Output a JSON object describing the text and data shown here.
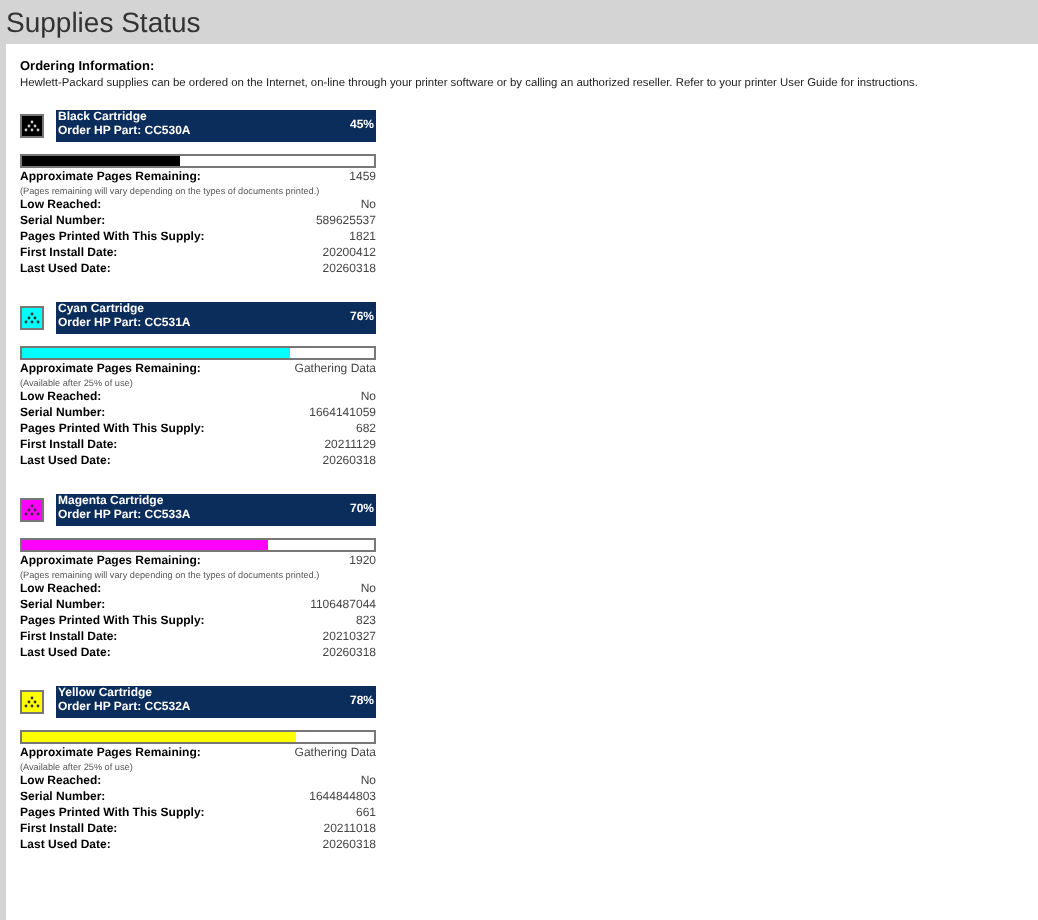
{
  "page_title": "Supplies Status",
  "ordering": {
    "heading": "Ordering Information:",
    "text": "Hewlett-Packard supplies can be ordered on the Internet, on-line through your printer software or by calling an authorized reseller. Refer to your printer User Guide for instructions."
  },
  "cartridges": [
    {
      "name": "Black Cartridge",
      "part": "Order HP Part: CC530A",
      "percent": "45%",
      "level": 0.45,
      "color": "#000000",
      "rows": [
        {
          "label": "Approximate Pages Remaining:",
          "value": "1459"
        },
        {
          "kind": "note",
          "label": "(Pages remaining will vary depending on the types of documents printed.)"
        },
        {
          "label": "Low Reached:",
          "value": "No"
        },
        {
          "label": "Serial Number:",
          "value": "589625537"
        },
        {
          "label": "Pages Printed With This Supply:",
          "value": "1821"
        },
        {
          "label": "First Install Date:",
          "value": "20200412"
        },
        {
          "label": "Last Used Date:",
          "value": "20260318"
        }
      ]
    },
    {
      "name": "Cyan Cartridge",
      "part": "Order HP Part: CC531A",
      "percent": "76%",
      "level": 0.76,
      "color": "#00ffff",
      "rows": [
        {
          "label": "Approximate Pages Remaining:",
          "value": "Gathering Data"
        },
        {
          "kind": "note",
          "label": "(Available after 25% of use)"
        },
        {
          "label": "Low Reached:",
          "value": "No"
        },
        {
          "label": "Serial Number:",
          "value": "1664141059"
        },
        {
          "label": "Pages Printed With This Supply:",
          "value": "682"
        },
        {
          "label": "First Install Date:",
          "value": "20211129"
        },
        {
          "label": "Last Used Date:",
          "value": "20260318"
        }
      ]
    },
    {
      "name": "Magenta Cartridge",
      "part": "Order HP Part: CC533A",
      "percent": "70%",
      "level": 0.7,
      "color": "#ff00ff",
      "rows": [
        {
          "label": "Approximate Pages Remaining:",
          "value": "1920"
        },
        {
          "kind": "note",
          "label": "(Pages remaining will vary depending on the types of documents printed.)"
        },
        {
          "label": "Low Reached:",
          "value": "No"
        },
        {
          "label": "Serial Number:",
          "value": "1106487044"
        },
        {
          "label": "Pages Printed With This Supply:",
          "value": "823"
        },
        {
          "label": "First Install Date:",
          "value": "20210327"
        },
        {
          "label": "Last Used Date:",
          "value": "20260318"
        }
      ]
    },
    {
      "name": "Yellow Cartridge",
      "part": "Order HP Part: CC532A",
      "percent": "78%",
      "level": 0.78,
      "color": "#ffff00",
      "rows": [
        {
          "label": "Approximate Pages Remaining:",
          "value": "Gathering Data"
        },
        {
          "kind": "note",
          "label": "(Available after 25% of use)"
        },
        {
          "label": "Low Reached:",
          "value": "No"
        },
        {
          "label": "Serial Number:",
          "value": "1644844803"
        },
        {
          "label": "Pages Printed With This Supply:",
          "value": "661"
        },
        {
          "label": "First Install Date:",
          "value": "20211018"
        },
        {
          "label": "Last Used Date:",
          "value": "20260318"
        }
      ]
    }
  ]
}
